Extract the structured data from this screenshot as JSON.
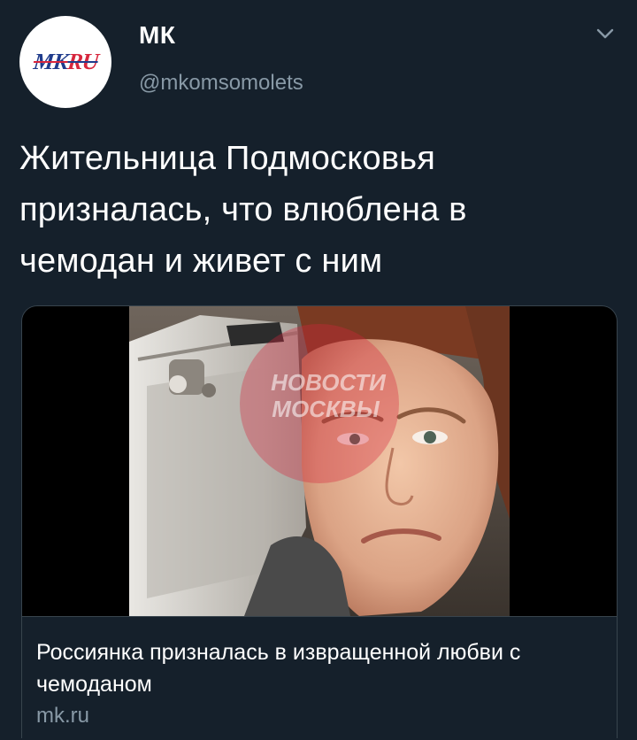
{
  "author": {
    "name": "МК",
    "handle": "@mkomsomolets",
    "avatar_logo": {
      "part1": "MK",
      "part2": "RU"
    }
  },
  "tweet": {
    "text": "Жительница Подмосковья призналась, что влюблена в чемодан и живет с ним"
  },
  "card": {
    "title": "Россиянка призналась в извращенной любви с чемоданом",
    "domain": "mk.ru",
    "image_alt": "Фото: женщина рядом с металлическим чемоданом",
    "watermark": {
      "line1": "НОВОСТИ",
      "line2": "МОСКВЫ"
    }
  },
  "icons": {
    "menu": "chevron-down-icon"
  },
  "colors": {
    "background": "#15202b",
    "secondary_text": "#8899a6",
    "border": "#38444d",
    "logo_blue": "#203c8c",
    "logo_red": "#d7263d"
  }
}
